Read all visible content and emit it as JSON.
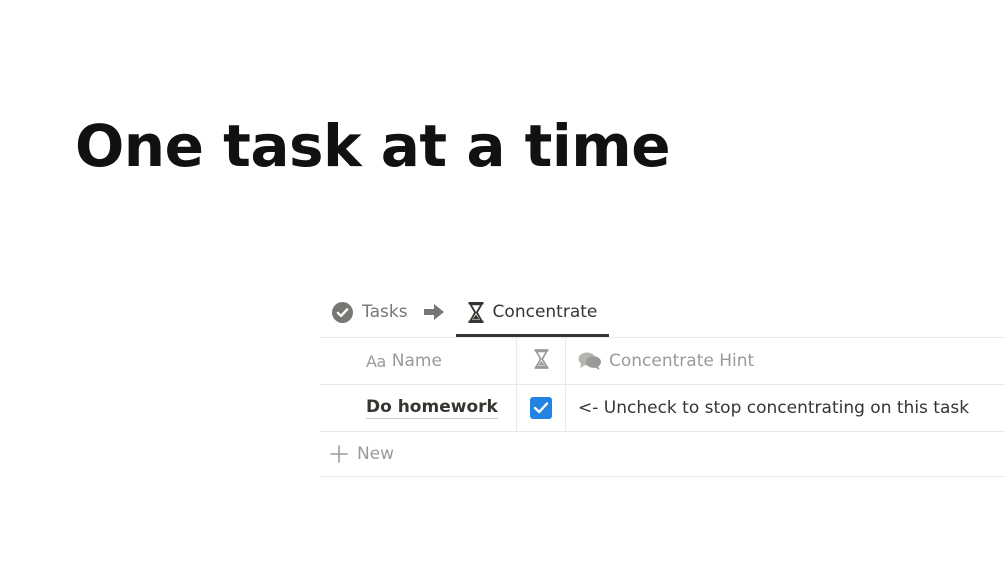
{
  "page": {
    "title": "One task at a time"
  },
  "views": {
    "tabs": [
      {
        "label": "Tasks",
        "icon": "check-circle-icon",
        "active": false
      },
      {
        "label": "Concentrate",
        "icon": "hourglass-icon",
        "active": true
      }
    ],
    "separator_icon": "arrow-right-icon"
  },
  "table": {
    "columns": [
      {
        "label": "Name",
        "icon": "text-aa-icon"
      },
      {
        "label": "",
        "icon": "hourglass-icon"
      },
      {
        "label": "Concentrate Hint",
        "icon": "speech-bubbles-icon"
      }
    ],
    "rows": [
      {
        "name": "Do homework",
        "concentrate": true,
        "hint": "<- Uncheck to stop concentrating on this task"
      }
    ],
    "new_label": "New"
  },
  "colors": {
    "accent": "#2383e2",
    "text": "#37352f",
    "muted": "#9b9a97",
    "border": "#e9e9e7"
  },
  "icons_glyph": {
    "text_aa": "Aa"
  }
}
